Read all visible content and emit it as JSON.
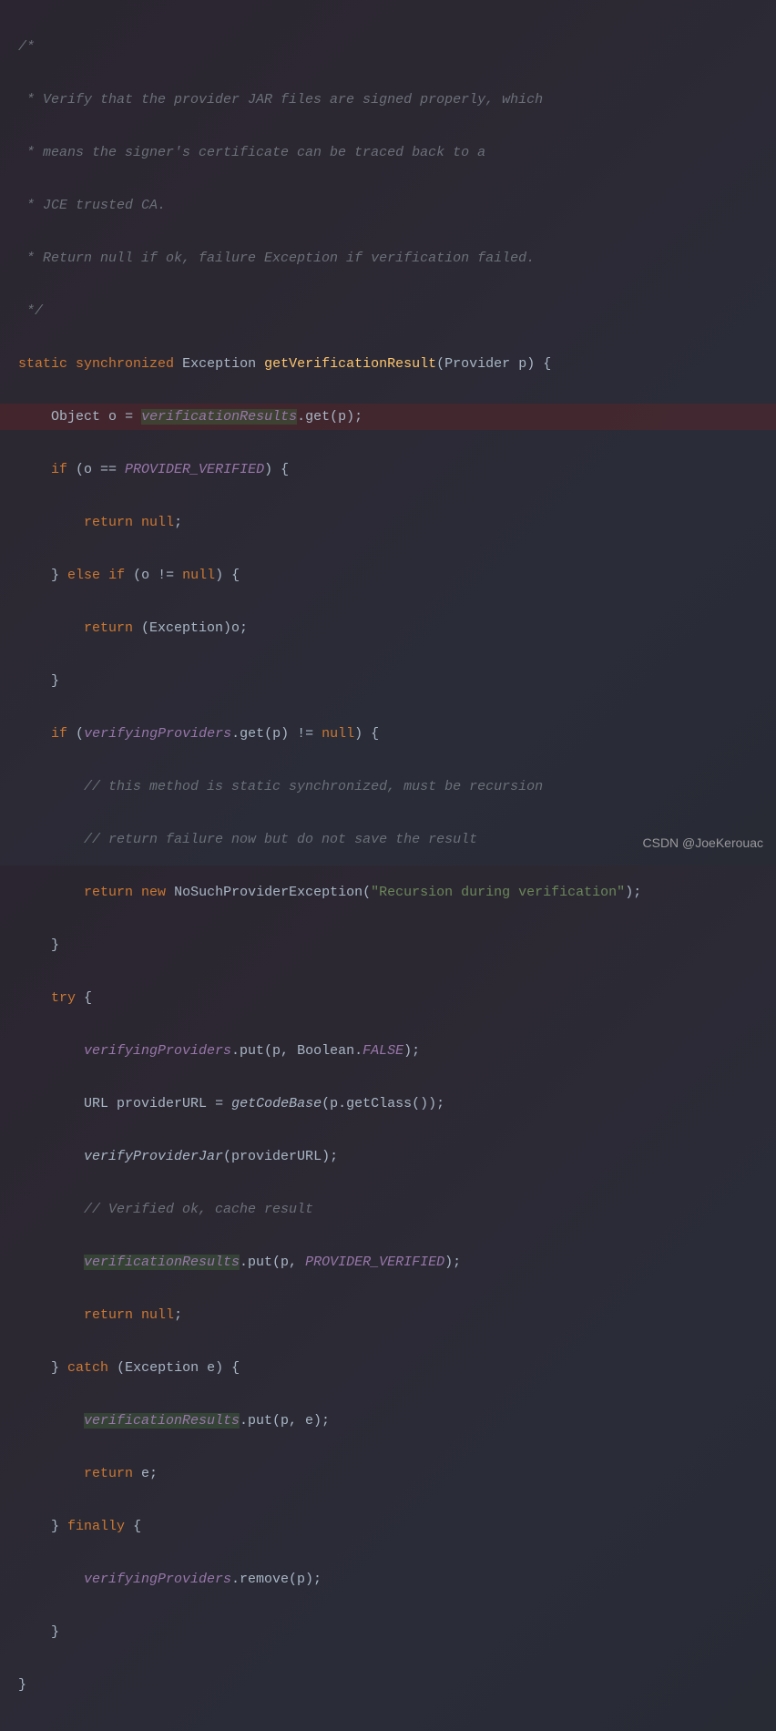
{
  "code": {
    "c1": "/*",
    "c2": " * Verify that the provider JAR files are signed properly, which",
    "c3": " * means the signer's certificate can be traced back to a",
    "c4": " * JCE trusted CA.",
    "c5": " * Return null if ok, failure Exception if verification failed.",
    "c6": " */",
    "kw_static": "static",
    "kw_synchronized": "synchronized",
    "type_exception": "Exception",
    "method_name": "getVerificationResult",
    "type_provider": "Provider",
    "param_p": "p",
    "brace_open": "{",
    "type_object": "Object",
    "var_o": "o",
    "eq": " = ",
    "field_verificationResults": "verificationResults",
    "dot_get_p": ".get(p);",
    "kw_if": "if",
    "cond_o_eq": " (o == ",
    "const_provider_verified": "PROVIDER_VERIFIED",
    "close_cond": ") {",
    "kw_return": "return",
    "kw_null": "null",
    "semi": ";",
    "brace_close": "}",
    "kw_else": "else",
    "cond_o_ne_null": " (o != ",
    "cast_exception": " (Exception)o;",
    "field_verifyingProviders": "verifyingProviders",
    "cond_get_p_ne_null": ".get(p) != ",
    "comment_recursion1": "// this method is static synchronized, must be recursion",
    "comment_recursion2": "// return failure now but do not save the result",
    "kw_new": "new",
    "type_nosuchprovider": "NoSuchProviderException",
    "str_recursion": "\"Recursion during verification\"",
    "close_paren_semi": ");",
    "kw_try": "try",
    "dot_put_p": ".put(p, ",
    "type_boolean": "Boolean",
    "const_false": "FALSE",
    "type_url": "URL",
    "var_providerURL": "providerURL",
    "method_getCodeBase": "getCodeBase",
    "p_getClass": "(p.getClass());",
    "method_verifyProviderJar": "verifyProviderJar",
    "arg_providerURL": "(providerURL);",
    "comment_verified": "// Verified ok, cache result",
    "dot_put_p_verified": ".put(p, ",
    "kw_catch": "catch",
    "catch_exception": " (Exception e) {",
    "dot_put_p_e": ".put(p, e);",
    "return_e": " e;",
    "kw_finally": "finally",
    "dot_remove_p": ".remove(p);"
  },
  "watermark": "CSDN @JoeKerouac"
}
